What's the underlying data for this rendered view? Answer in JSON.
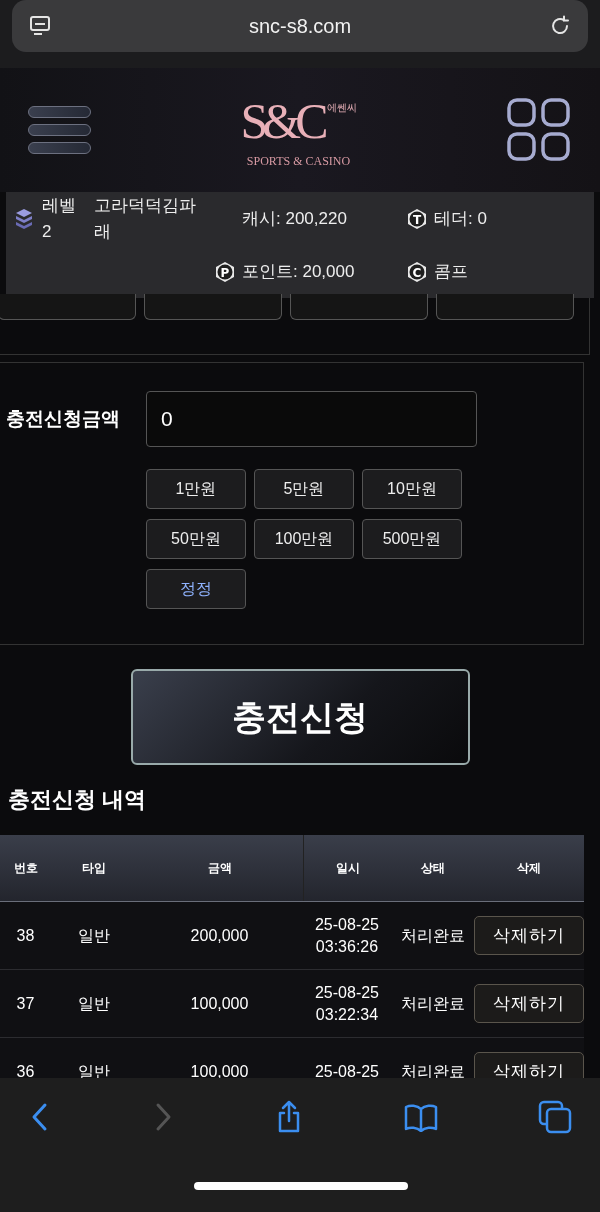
{
  "browser": {
    "url": "snc-s8.com"
  },
  "logo": {
    "korean": "에쎈씨",
    "mark": "S&C",
    "tagline": "SPORTS & CASINO"
  },
  "user": {
    "level": "레벨 2",
    "name": "고라덕덕김파래",
    "cash": "캐시: 200,220",
    "tether": "테더: 0",
    "points": "포인트: 20,000",
    "comp": "콤프",
    "tether_icon": "T",
    "points_icon": "P",
    "comp_icon": "C"
  },
  "deposit": {
    "label": "충전신청금액",
    "value": "0",
    "amounts": [
      {
        "label": "1만원",
        "kind": "amount"
      },
      {
        "label": "5만원",
        "kind": "amount"
      },
      {
        "label": "10만원",
        "kind": "amount"
      },
      {
        "label": "50만원",
        "kind": "amount"
      },
      {
        "label": "100만원",
        "kind": "amount"
      },
      {
        "label": "500만원",
        "kind": "amount"
      },
      {
        "label": "정정",
        "kind": "reset"
      }
    ],
    "submit": "충전신청"
  },
  "history": {
    "title": "충전신청 내역",
    "columns": [
      "번호",
      "타입",
      "금액",
      "일시",
      "상태",
      "삭제"
    ],
    "rows": [
      {
        "no": "38",
        "type": "일반",
        "amount": "200,000",
        "date": "25-08-25",
        "time": "03:36:26",
        "status": "처리완료",
        "action": "삭제하기"
      },
      {
        "no": "37",
        "type": "일반",
        "amount": "100,000",
        "date": "25-08-25",
        "time": "03:22:34",
        "status": "처리완료",
        "action": "삭제하기"
      },
      {
        "no": "36",
        "type": "일반",
        "amount": "100,000",
        "date": "25-08-25",
        "status": "처리완료",
        "action": "삭제하기"
      }
    ]
  }
}
